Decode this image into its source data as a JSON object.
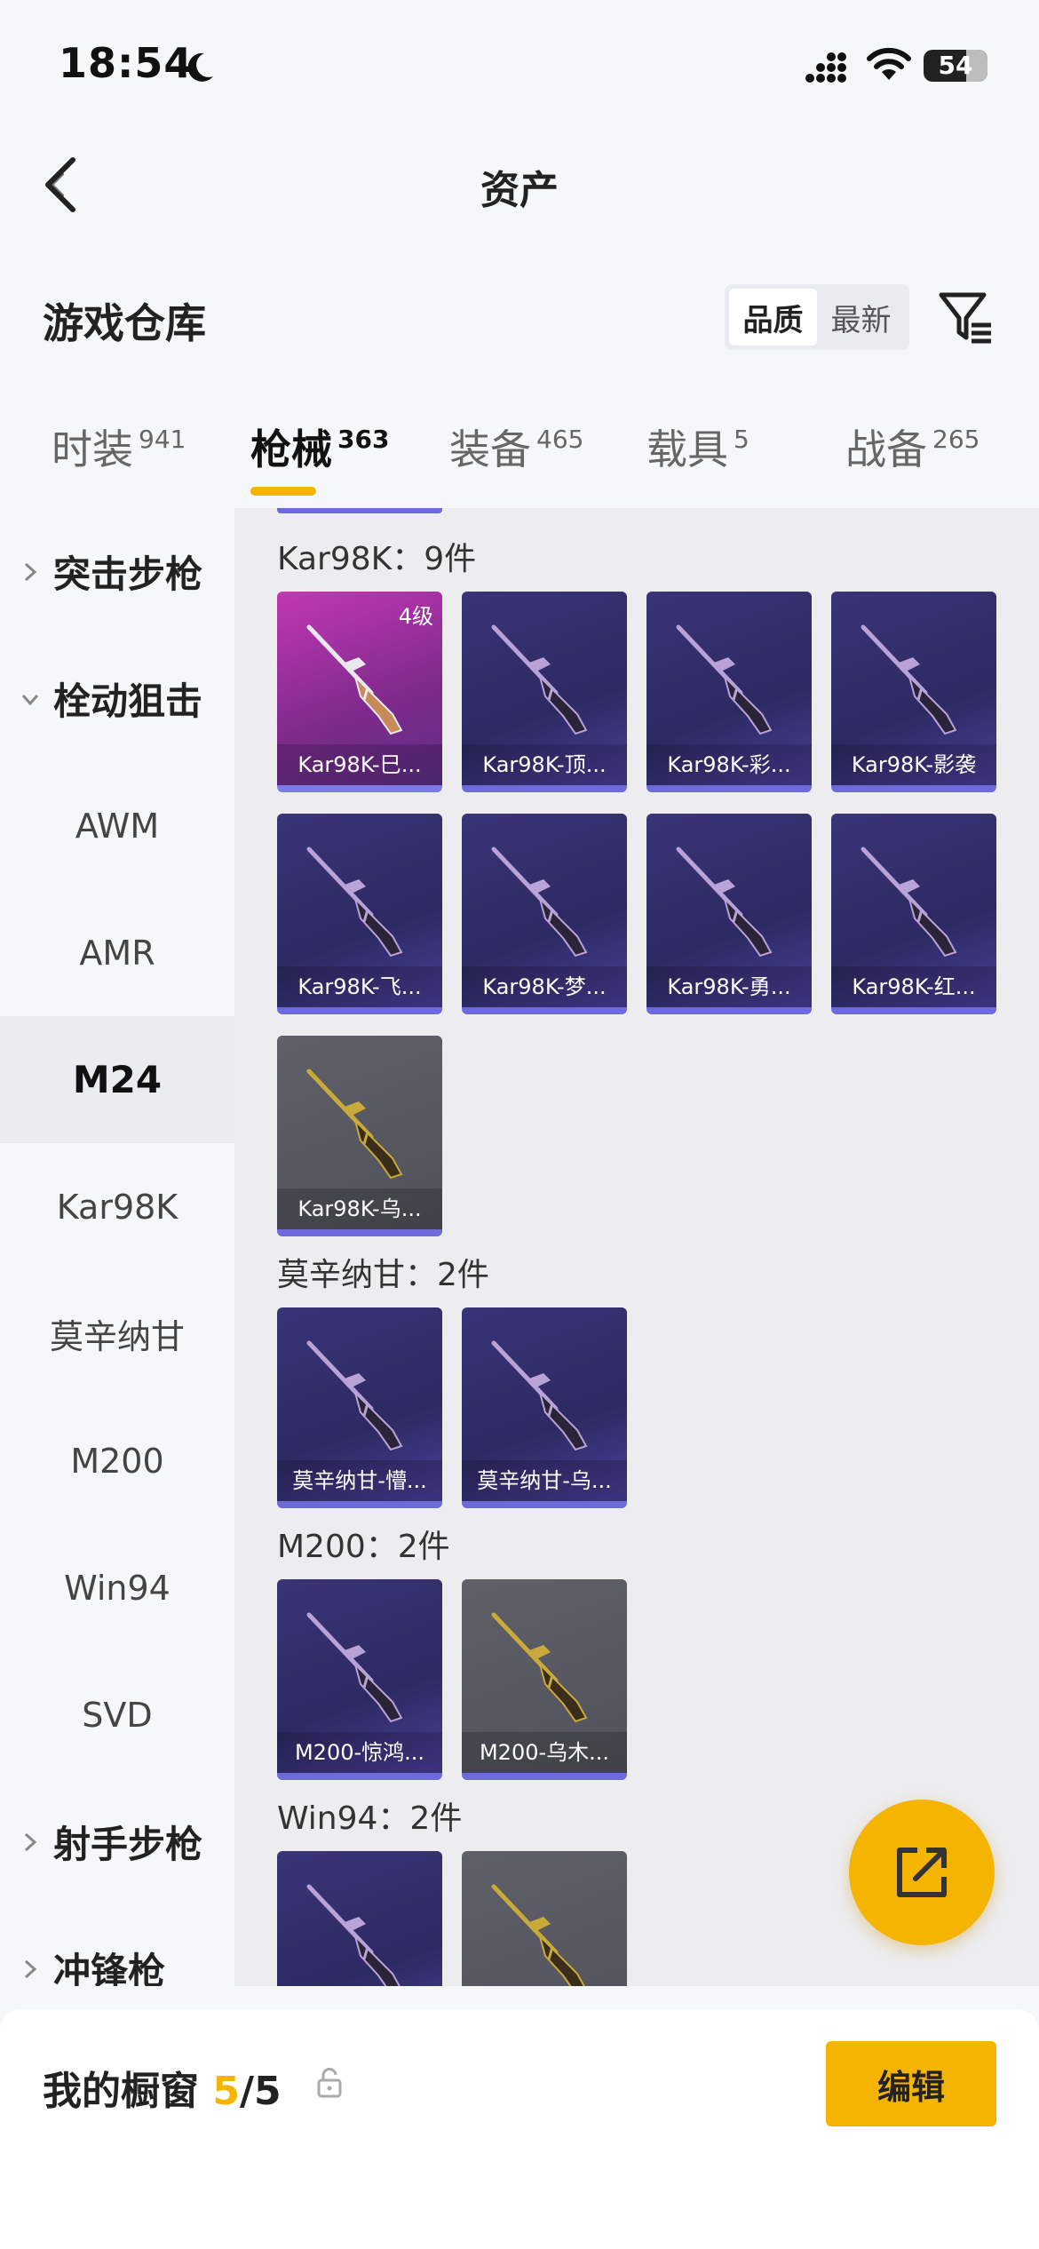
{
  "status": {
    "time": "18:54",
    "battery": "54"
  },
  "nav": {
    "title": "资产"
  },
  "warehouse": {
    "title": "游戏仓库",
    "sort_options": [
      "品质",
      "最新"
    ],
    "active_sort": "品质"
  },
  "tabs": [
    {
      "label": "时装",
      "count": "941"
    },
    {
      "label": "枪械",
      "count": "363"
    },
    {
      "label": "装备",
      "count": "465"
    },
    {
      "label": "载具",
      "count": "5"
    },
    {
      "label": "战备",
      "count": "265"
    }
  ],
  "sidebar": {
    "groups": [
      {
        "label": "突击步枪",
        "expanded": false
      },
      {
        "label": "栓动狙击",
        "expanded": true
      },
      {
        "label": "射手步枪",
        "expanded": false
      },
      {
        "label": "冲锋枪",
        "expanded": false
      }
    ],
    "items": [
      "AWM",
      "AMR",
      "M24",
      "Kar98K",
      "莫辛纳甘",
      "M200",
      "Win94",
      "SVD"
    ],
    "active_item": "M24"
  },
  "sections": [
    {
      "title": "Kar98K：9件",
      "cards": [
        {
          "name": "Kar98K-巳...",
          "rarity": "pink",
          "level": "4级"
        },
        {
          "name": "Kar98K-顶...",
          "rarity": "purple"
        },
        {
          "name": "Kar98K-彩...",
          "rarity": "purple"
        },
        {
          "name": "Kar98K-影袭",
          "rarity": "purple"
        },
        {
          "name": "Kar98K-飞...",
          "rarity": "purple"
        },
        {
          "name": "Kar98K-梦...",
          "rarity": "purple"
        },
        {
          "name": "Kar98K-勇...",
          "rarity": "purple"
        },
        {
          "name": "Kar98K-红...",
          "rarity": "purple"
        },
        {
          "name": "Kar98K-乌...",
          "rarity": "gray"
        }
      ]
    },
    {
      "title": "莫辛纳甘：2件",
      "cards": [
        {
          "name": "莫辛纳甘-懵...",
          "rarity": "purple"
        },
        {
          "name": "莫辛纳甘-乌...",
          "rarity": "purple"
        }
      ]
    },
    {
      "title": "M200：2件",
      "cards": [
        {
          "name": "M200-惊鸿...",
          "rarity": "purple"
        },
        {
          "name": "M200-乌木...",
          "rarity": "gray"
        }
      ]
    },
    {
      "title": "Win94：2件",
      "cards": [
        {
          "name": "",
          "rarity": "purple"
        },
        {
          "name": "",
          "rarity": "gray"
        }
      ]
    }
  ],
  "showcase": {
    "label": "我的橱窗",
    "current": "5",
    "total": "/5",
    "edit_label": "编辑"
  },
  "colors": {
    "accent": "#f4b400",
    "purple_card": "#3a3478",
    "pink_card": "#c238b4",
    "gray_card": "#5f6068"
  }
}
